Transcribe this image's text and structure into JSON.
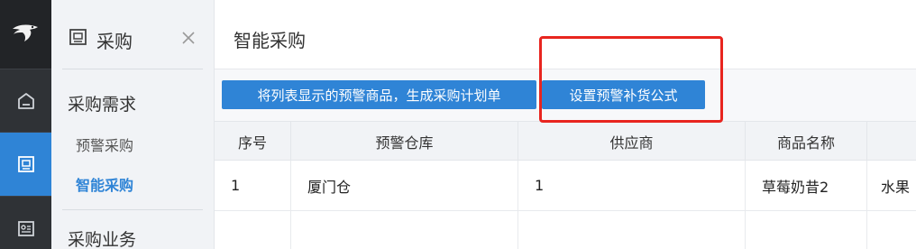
{
  "rail": {
    "logo_icon": "bird-logo-icon",
    "items": [
      {
        "icon": "home-icon",
        "active": false
      },
      {
        "icon": "purchase-icon",
        "active": true
      },
      {
        "icon": "contact-card-icon",
        "active": false
      }
    ]
  },
  "sidebar": {
    "title": "采购",
    "close_icon": "close-icon",
    "groups": [
      {
        "title": "采购需求",
        "items": [
          {
            "label": "预警采购",
            "active": false
          },
          {
            "label": "智能采购",
            "active": true
          }
        ]
      },
      {
        "title": "采购业务",
        "items": []
      }
    ]
  },
  "main": {
    "title": "智能采购",
    "toolbar": {
      "generate_plan_label": "将列表显示的预警商品，生成采购计划单",
      "formula_label": "设置预警补货公式"
    },
    "table": {
      "columns": [
        "序号",
        "预警仓库",
        "供应商",
        "商品名称",
        ""
      ],
      "rows": [
        [
          "1",
          "厦门仓",
          "1",
          "草莓奶昔2",
          "水果"
        ]
      ]
    }
  },
  "colors": {
    "accent": "#2f84d6",
    "highlight": "#e8251f",
    "rail_bg": "#2f3236"
  }
}
